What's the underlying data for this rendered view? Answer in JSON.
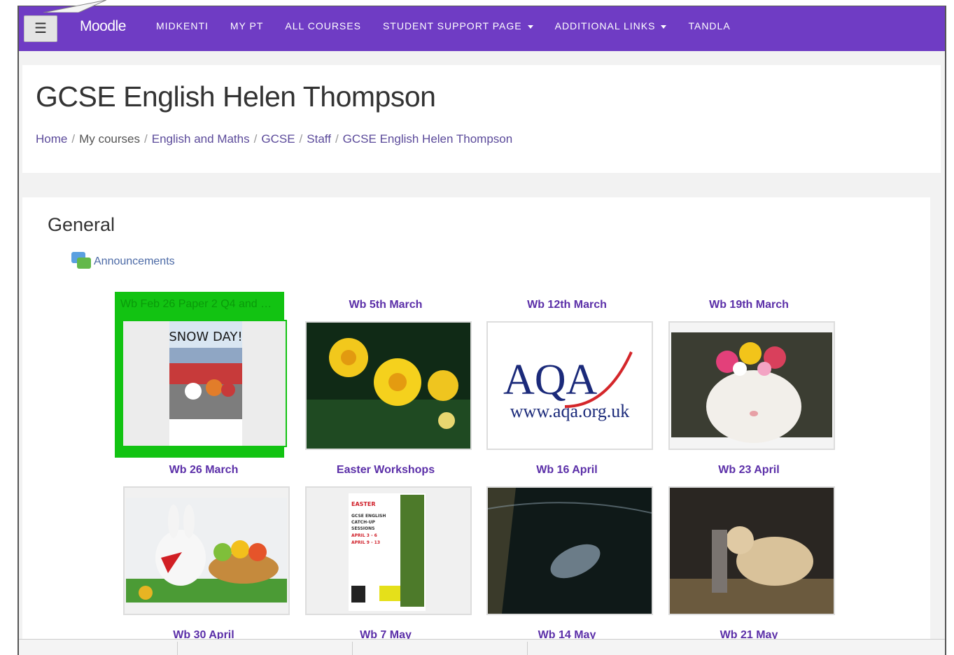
{
  "app": {
    "brand": "Moodle"
  },
  "nav": {
    "items": [
      {
        "label": "MIDKENTI",
        "dropdown": false
      },
      {
        "label": "MY PT",
        "dropdown": false
      },
      {
        "label": "ALL COURSES",
        "dropdown": false
      },
      {
        "label": "STUDENT SUPPORT PAGE",
        "dropdown": true
      },
      {
        "label": "ADDITIONAL LINKS",
        "dropdown": true
      },
      {
        "label": "TANDLA",
        "dropdown": false
      }
    ]
  },
  "page": {
    "title": "GCSE English Helen Thompson"
  },
  "breadcrumb": [
    "Home",
    "My courses",
    "English and Maths",
    "GCSE",
    "Staff",
    "GCSE English Helen Thompson"
  ],
  "section": {
    "title": "General"
  },
  "announcements": {
    "label": "Announcements",
    "icon": "forum-icon"
  },
  "tiles": [
    {
      "caption": "Wb Feb 26 Paper 2 Q4 and P2 ...",
      "image": "snow-day-image",
      "image_text": "SNOW DAY!",
      "selected": true
    },
    {
      "caption": "Wb 5th March",
      "image": "daffodils-image",
      "selected": false
    },
    {
      "caption": "Wb 12th March",
      "image": "aqa-logo-image",
      "image_text": "AQA",
      "image_sub": "www.aqa.org.uk",
      "selected": false
    },
    {
      "caption": "Wb 19th March",
      "image": "cat-flower-crown-image",
      "selected": false
    },
    {
      "caption": "Wb 26 March",
      "image": "easter-bunny-image",
      "selected": false
    },
    {
      "caption": "Easter Workshops",
      "image": "easter-workshop-poster-image",
      "poster_lines": [
        "EASTER",
        "GCSE ENGLISH",
        "CATCH-UP",
        "SESSIONS",
        "APRIL 3 - 6",
        "APRIL 9 - 13"
      ],
      "selected": false
    },
    {
      "caption": "Wb 16 April",
      "image": "seal-underwater-image",
      "selected": false
    },
    {
      "caption": "Wb 23 April",
      "image": "dog-and-goat-image",
      "selected": false
    }
  ],
  "next_row": [
    "Wb 30 April",
    "Wb 7 May",
    "Wb 14 May",
    "Wb 21 May"
  ],
  "colors": {
    "nav": "#6f3cc4",
    "selected": "#12c312",
    "link": "#5b2fa8"
  }
}
